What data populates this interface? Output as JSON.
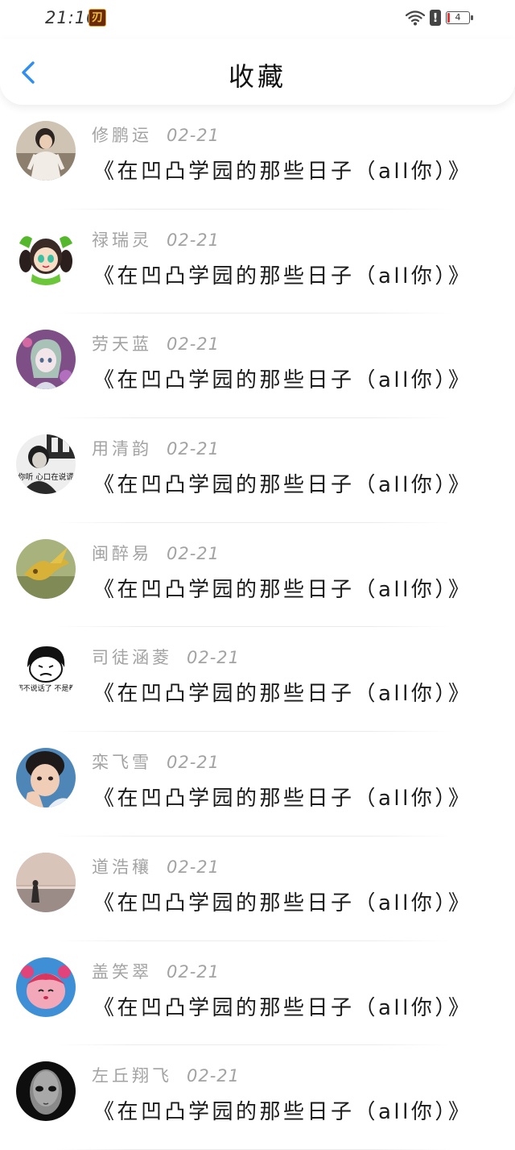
{
  "status_bar": {
    "time": "21:10",
    "app_icon_glyph": "刃",
    "battery_level": "4"
  },
  "header": {
    "title": "收藏"
  },
  "colors": {
    "accent": "#2f8ef0",
    "meta_text": "#a3a3a3",
    "title_text": "#1a1a1a"
  },
  "favorites": [
    {
      "author": "修鹏运",
      "date": "02-21",
      "title": "《在凹凸学园的那些日子（all你）》"
    },
    {
      "author": "禄瑞灵",
      "date": "02-21",
      "title": "《在凹凸学园的那些日子（all你）》"
    },
    {
      "author": "劳天蓝",
      "date": "02-21",
      "title": "《在凹凸学园的那些日子（all你）》"
    },
    {
      "author": "用清韵",
      "date": "02-21",
      "title": "《在凹凸学园的那些日子（all你）》",
      "avatar_caption": "你听 心口在说谎"
    },
    {
      "author": "闽醉易",
      "date": "02-21",
      "title": "《在凹凸学园的那些日子（all你）》"
    },
    {
      "author": "司徒涵菱",
      "date": "02-21",
      "title": "《在凹凸学园的那些日子（all你）》",
      "avatar_caption": "怎么都不说话了 不是都在吗"
    },
    {
      "author": "栾飞雪",
      "date": "02-21",
      "title": "《在凹凸学园的那些日子（all你）》"
    },
    {
      "author": "道浩穰",
      "date": "02-21",
      "title": "《在凹凸学园的那些日子（all你）》"
    },
    {
      "author": "盖笑翠",
      "date": "02-21",
      "title": "《在凹凸学园的那些日子（all你）》"
    },
    {
      "author": "左丘翔飞",
      "date": "02-21",
      "title": "《在凹凸学园的那些日子（all你）》"
    }
  ]
}
